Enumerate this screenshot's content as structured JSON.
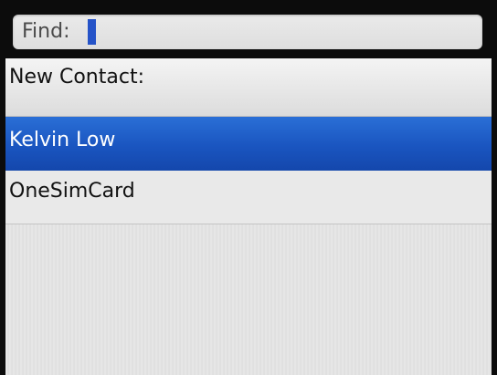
{
  "find": {
    "label": "Find:",
    "value": ""
  },
  "list": {
    "section_header": "New Contact:",
    "items": [
      {
        "label": "Kelvin Low",
        "selected": true
      },
      {
        "label": "OneSimCard",
        "selected": false
      }
    ]
  },
  "colors": {
    "selection": "#1a55c0",
    "cursor": "#2553c8"
  }
}
